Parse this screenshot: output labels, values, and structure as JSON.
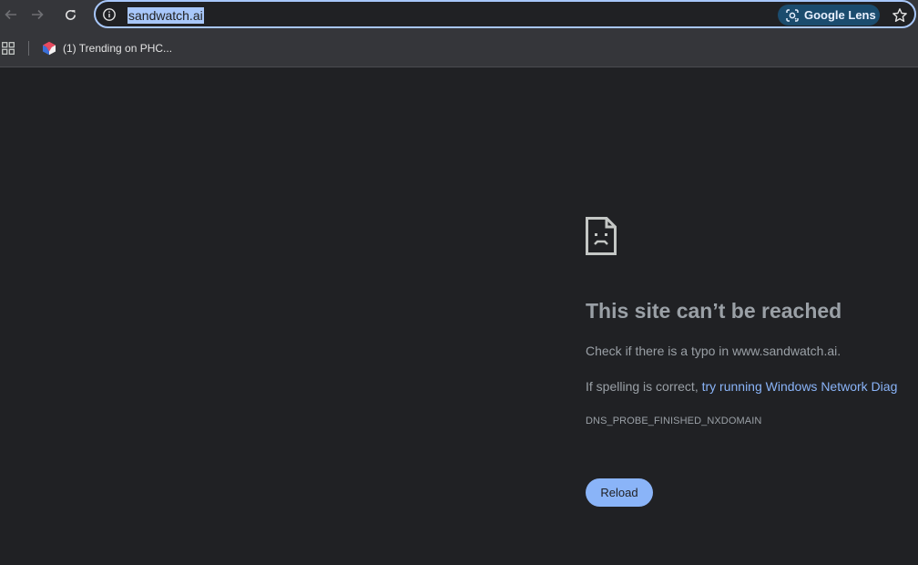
{
  "toolbar": {
    "back_icon": "arrow-left-icon",
    "forward_icon": "arrow-right-icon",
    "reload_icon": "reload-icon",
    "omnibox": {
      "info_icon": "info-icon",
      "url": "sandwatch.ai",
      "lens_label": "Google Lens",
      "star_icon": "star-icon"
    }
  },
  "bookmarks": {
    "apps_icon": "apps-grid-icon",
    "items": [
      {
        "label": "(1) Trending on PHC...",
        "icon": "phc-favicon-icon"
      }
    ]
  },
  "error": {
    "icon": "sad-page-icon",
    "title": "This site can’t be reached",
    "line1": "Check if there is a typo in www.sandwatch.ai.",
    "line2_prefix": "If spelling is correct, ",
    "line2_link": "try running Windows Network Diag",
    "code": "DNS_PROBE_FINISHED_NXDOMAIN",
    "reload_label": "Reload"
  },
  "colors": {
    "page_bg": "#202124",
    "toolbar_bg": "#35363a",
    "accent": "#8ab4f8",
    "omnibox_border": "#a8c7fa",
    "text_muted": "#9aa0a6"
  }
}
